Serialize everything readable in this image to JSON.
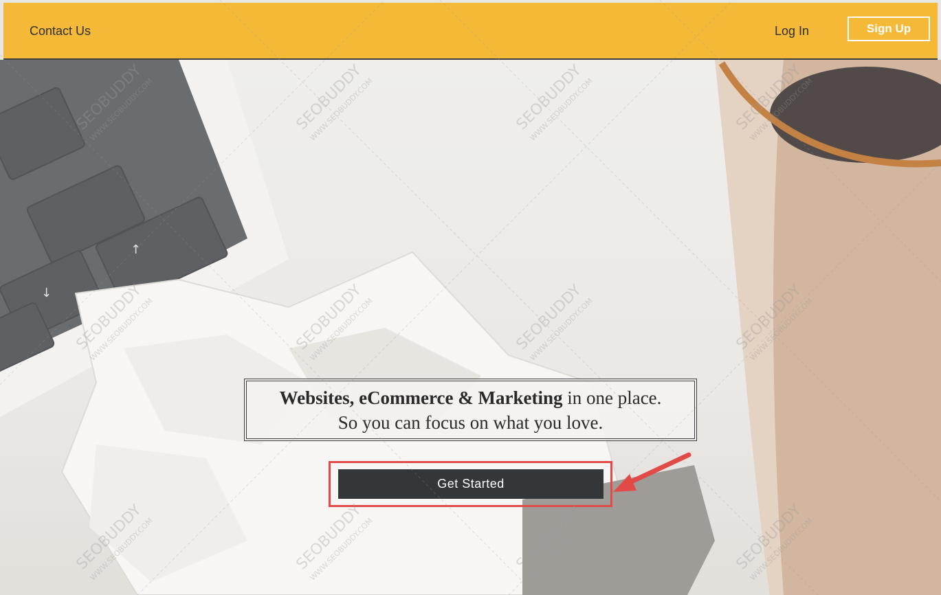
{
  "header": {
    "contact_label": "Contact Us",
    "login_label": "Log In",
    "signup_label": "Sign Up"
  },
  "hero": {
    "headline_bold": "Websites, eCommerce & Marketing",
    "headline_rest": " in one place.",
    "headline_line2": "So you can focus on what you love.",
    "cta_label": "Get Started"
  },
  "watermark": {
    "brand": "SEOBUDDY",
    "url": "WWW.SEOBUDDY.COM"
  },
  "colors": {
    "header_bg": "#f3b937",
    "cta_bg": "#33373a",
    "highlight": "#e24a48"
  }
}
